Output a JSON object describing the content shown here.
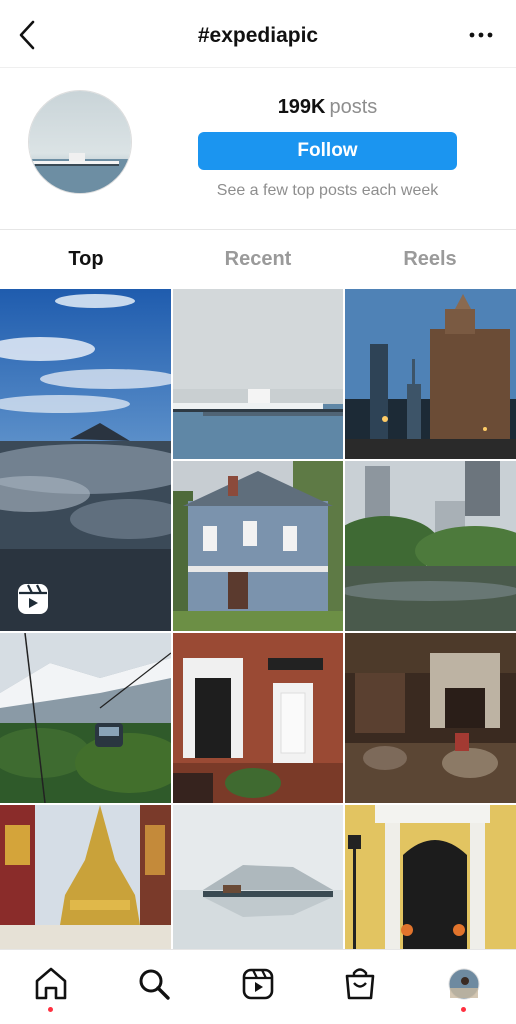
{
  "header": {
    "title": "#expediapic",
    "back_icon": "chevron-left-icon",
    "more_icon": "more-horizontal-icon"
  },
  "profile": {
    "post_count": "199K",
    "post_label": "posts",
    "follow_label": "Follow",
    "hint": "See a few top posts each week",
    "accent_color": "#1b95f0"
  },
  "tabs": [
    {
      "label": "Top",
      "active": true
    },
    {
      "label": "Recent",
      "active": false
    },
    {
      "label": "Reels",
      "active": false
    }
  ],
  "grid": {
    "items": [
      {
        "subject": "mountain above clouds",
        "icon": "reels-icon"
      },
      {
        "subject": "pier on misty lake"
      },
      {
        "subject": "city skyline at dusk"
      },
      {
        "subject": "victorian house"
      },
      {
        "subject": "park pond with skyscrapers"
      },
      {
        "subject": "cable car over forest"
      },
      {
        "subject": "brick townhouse doorway"
      },
      {
        "subject": "ornate interior with fireplace"
      },
      {
        "subject": "golden temple stupa"
      },
      {
        "subject": "misty lake reflection"
      },
      {
        "subject": "yellow building doorway"
      }
    ]
  },
  "bottom_nav": [
    {
      "name": "home-icon",
      "notification": true
    },
    {
      "name": "search-icon",
      "notification": false
    },
    {
      "name": "reels-icon",
      "notification": false
    },
    {
      "name": "shop-icon",
      "notification": false
    },
    {
      "name": "profile-avatar",
      "notification": true
    }
  ]
}
